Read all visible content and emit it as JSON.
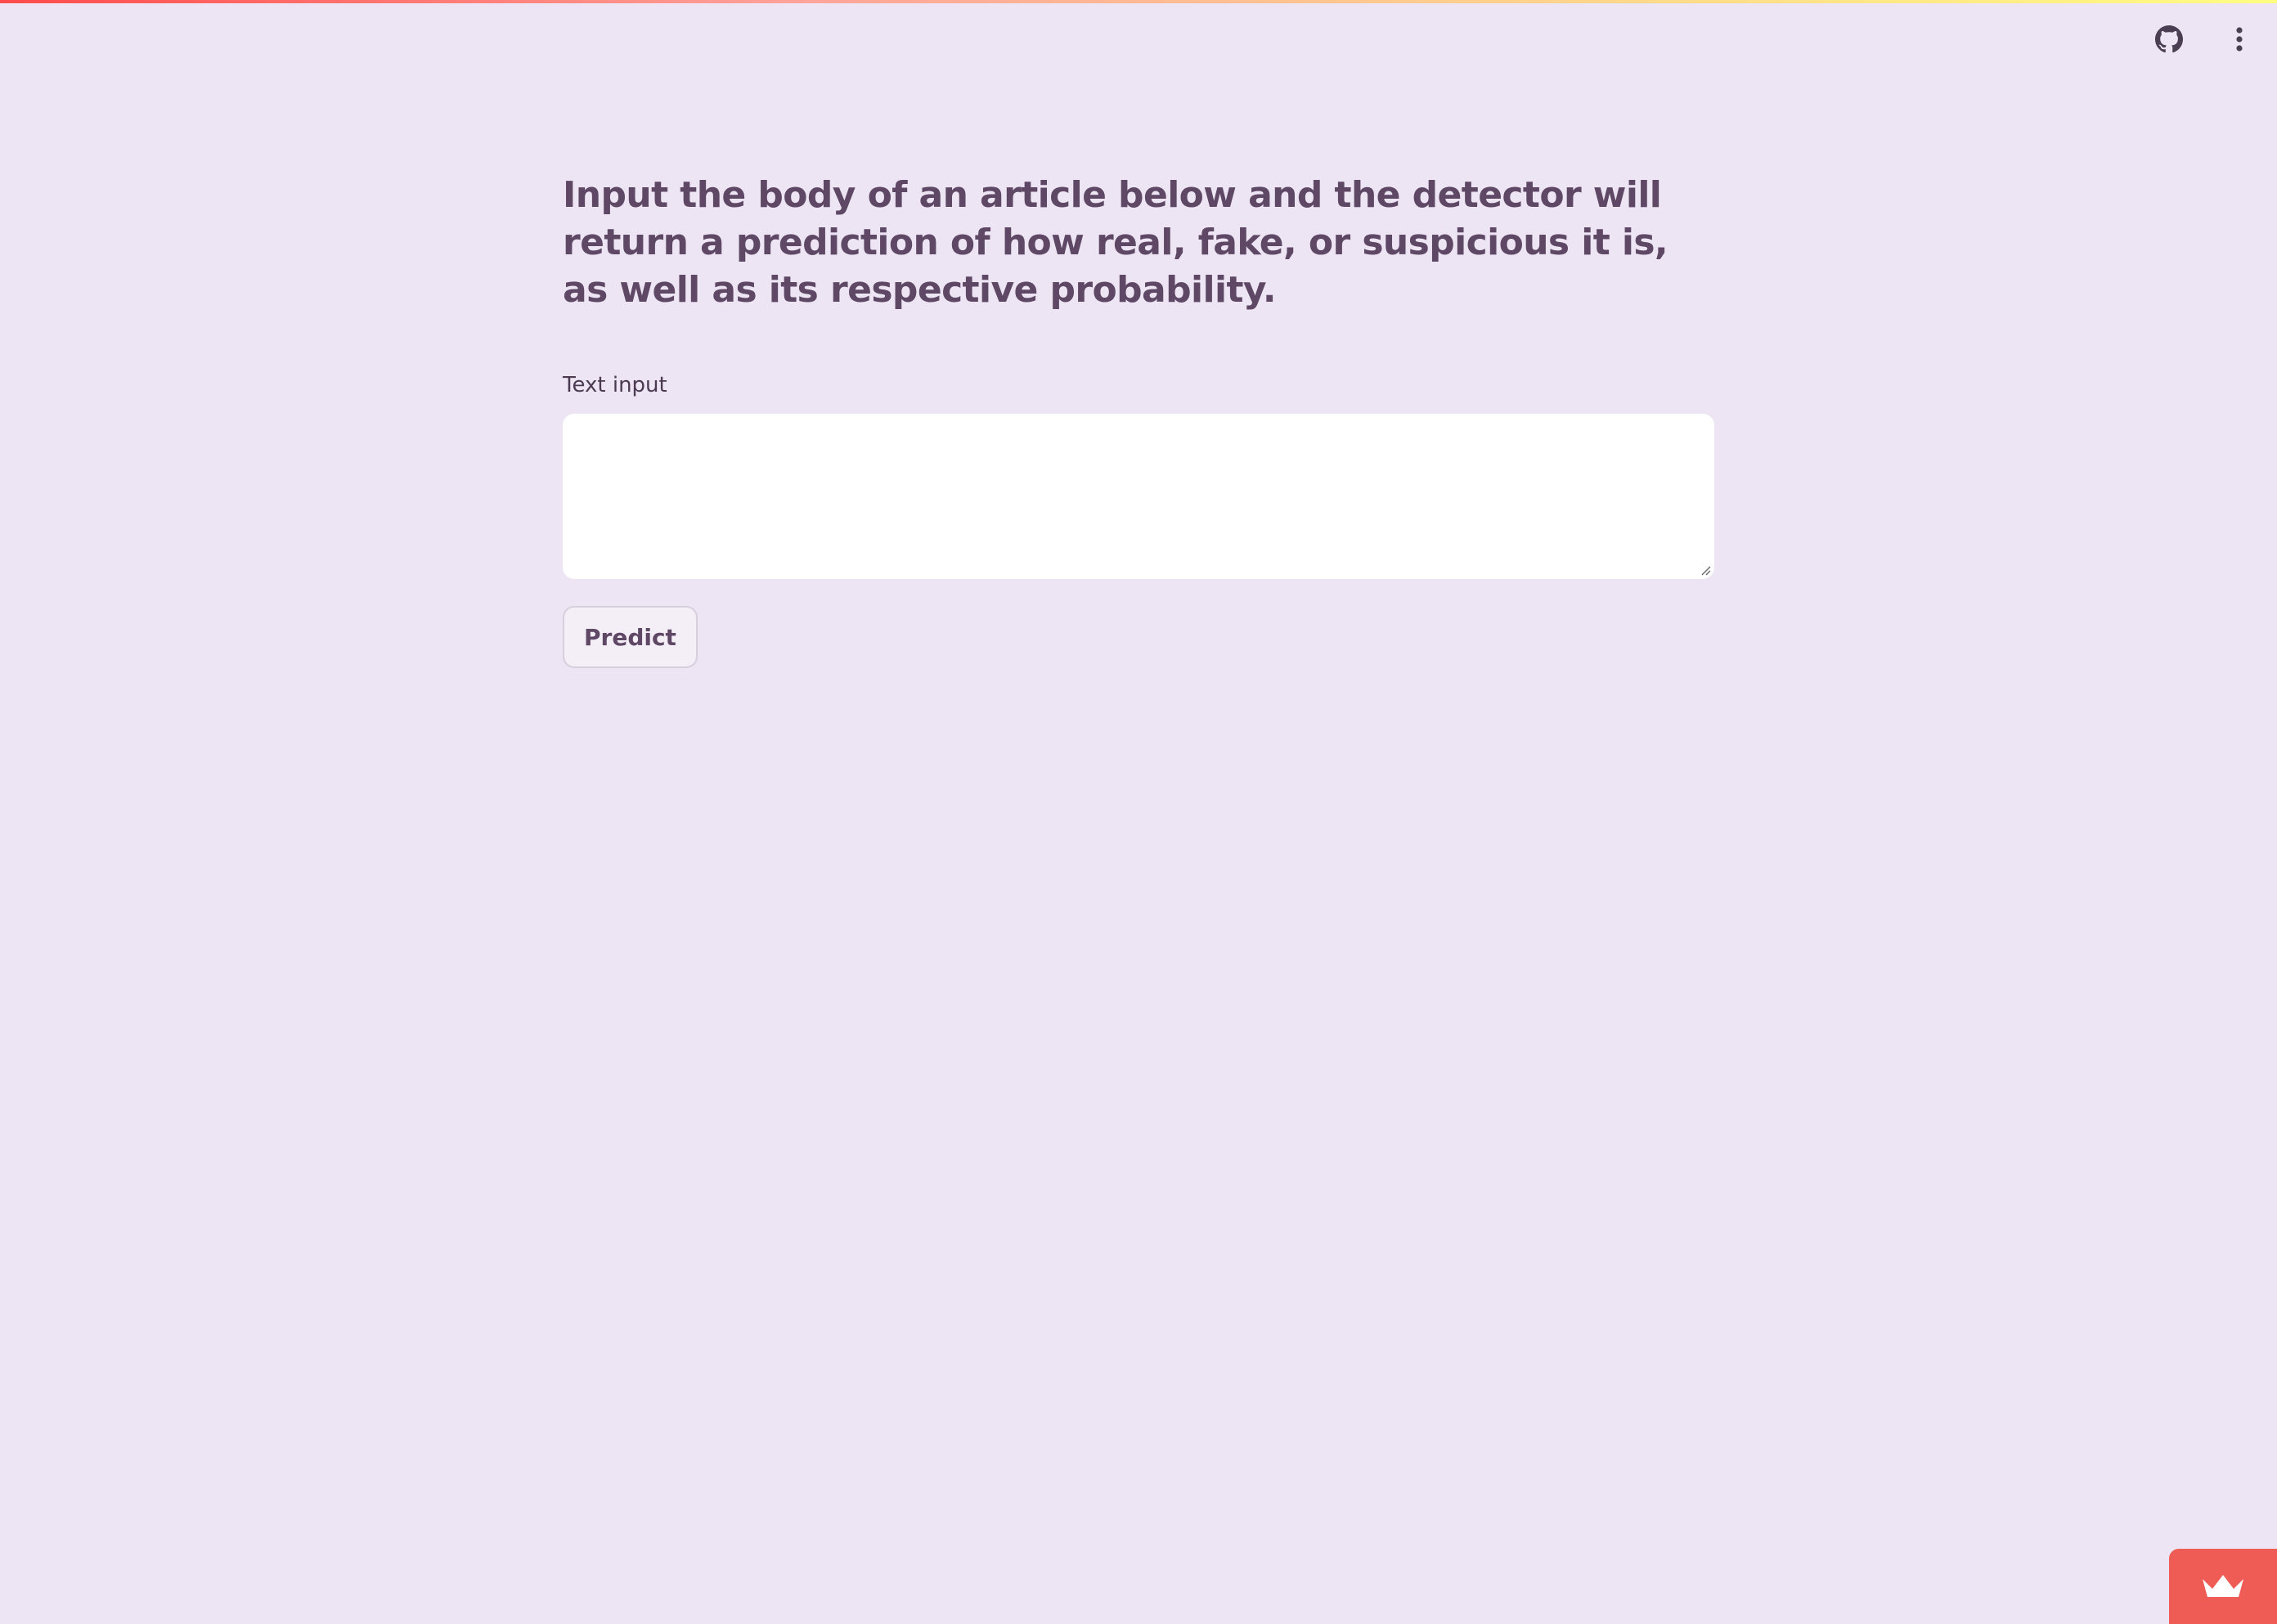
{
  "header": {
    "github_icon": "github-icon",
    "menu_icon": "vertical-ellipsis-icon"
  },
  "main": {
    "title": "Input the body of an article below and the detector will return a prediction of how real, fake, or suspicious it is, as well as its respective probability.",
    "text_input": {
      "label": "Text input",
      "value": "",
      "placeholder": ""
    },
    "predict_button": "Predict"
  },
  "footer": {
    "badge_icon": "crown-icon"
  },
  "colors": {
    "background": "#ede5f4",
    "text": "#5e4865",
    "badge": "#ef5b55"
  }
}
